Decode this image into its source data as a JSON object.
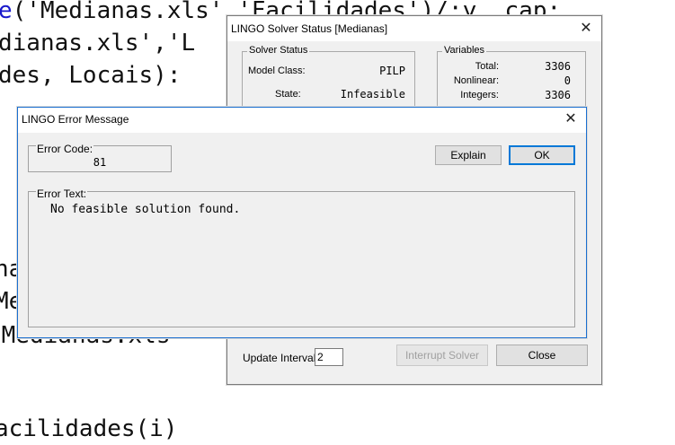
{
  "editor": {
    "lines": [
      {
        "kw": "e",
        "text": "('Medianas.xls','Facilidades')/:y, cap;"
      },
      {
        "kw": "",
        "text": "dianas.xls','L"
      },
      {
        "kw": "",
        "text": "des, Locais):"
      },
      {
        "kw": "",
        "text": "na"
      },
      {
        "kw": "",
        "text": "Me"
      },
      {
        "kw": "",
        "text": " Medianas.xls"
      },
      {
        "kw": "",
        "text": "acilidades(i)"
      }
    ]
  },
  "solver_status": {
    "title": "LINGO Solver Status [Medianas]",
    "solver_group": "Solver Status",
    "model_class_label": "Model Class:",
    "model_class_value": "PILP",
    "state_label": "State:",
    "state_value": "Infeasible",
    "variables_group": "Variables",
    "total_label": "Total:",
    "total_value": "3306",
    "nonlinear_label": "Nonlinear:",
    "nonlinear_value": "0",
    "integers_label": "Integers:",
    "integers_value": "3306",
    "update_interval_label": "Update Interval:",
    "update_interval_value": "2",
    "interrupt_label": "Interrupt Solver",
    "close_label": "Close"
  },
  "error_dialog": {
    "title": "LINGO Error Message",
    "error_code_label": "Error Code:",
    "error_code_value": "81",
    "explain_label": "Explain",
    "ok_label": "OK",
    "error_text_label": "Error Text:",
    "error_text_value": "No feasible solution found."
  }
}
